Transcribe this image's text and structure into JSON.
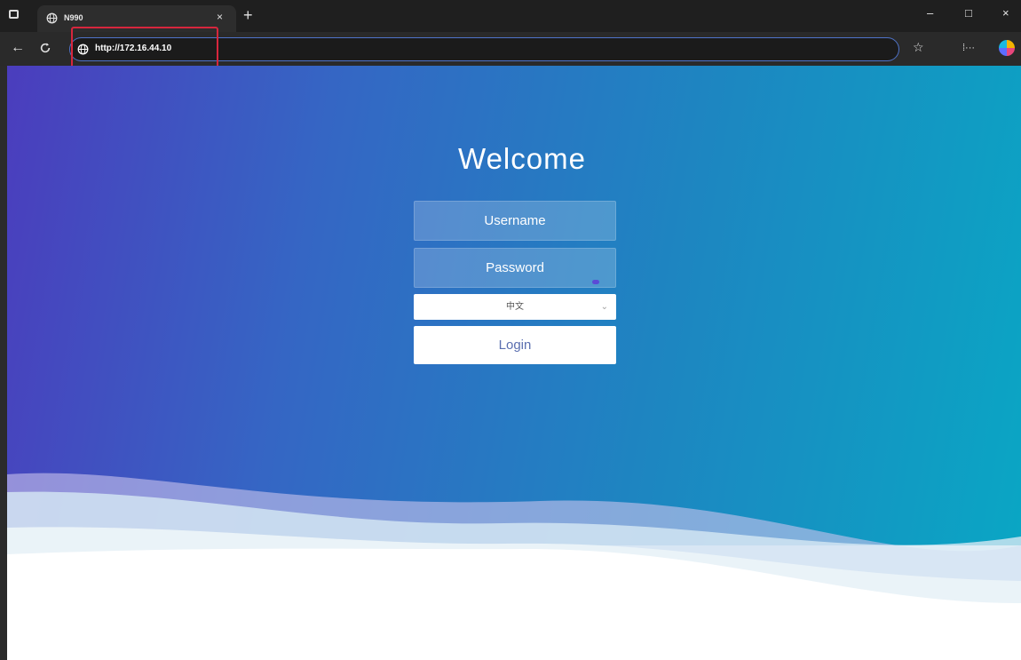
{
  "browser": {
    "tab_title": "N990",
    "tab_close": "×",
    "new_tab": "+",
    "url": "http://172.16.44.10",
    "window_controls": {
      "minimize": "–",
      "maximize": "□",
      "close": "×"
    },
    "icons": [
      "tab-actions-icon",
      "globe-icon",
      "back-icon",
      "refresh-icon",
      "favorite-icon",
      "more-icon",
      "copilot-icon"
    ]
  },
  "login": {
    "title": "Welcome",
    "username_placeholder": "Username",
    "password_placeholder": "Password",
    "language_selected": "中文",
    "login_label": "Login"
  },
  "colors": {
    "gradient_start": "#4b3dbd",
    "gradient_end": "#0aa6c4",
    "highlight_box": "#d7263d",
    "address_focus": "#4f73c9"
  }
}
